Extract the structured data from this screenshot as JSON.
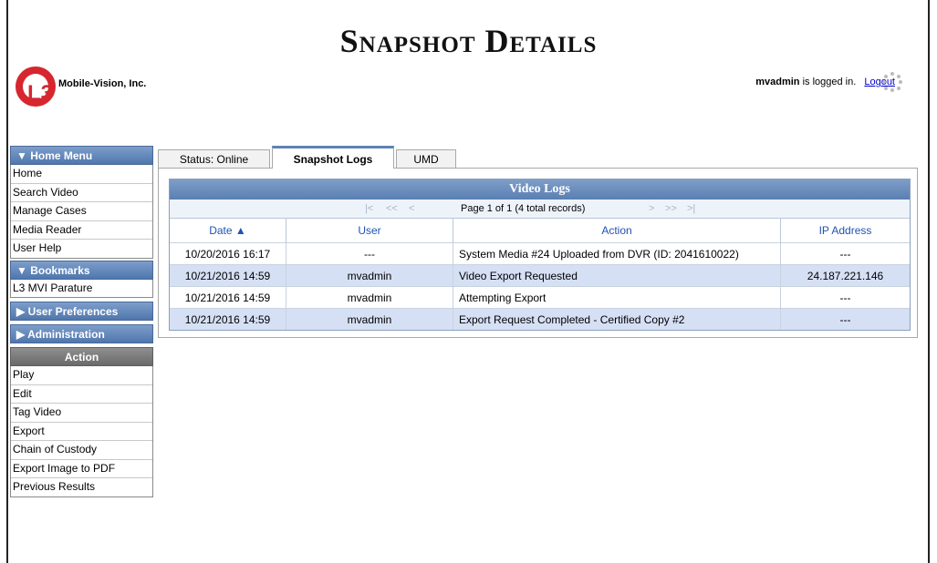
{
  "page": {
    "title": "Snapshot Details"
  },
  "brand": {
    "logo_text": "L3",
    "company": "Mobile-Vision, Inc."
  },
  "session": {
    "username": "mvadmin",
    "logged_in_suffix": " is logged in.",
    "logout_label": "Logout"
  },
  "sidebar": {
    "home_menu": {
      "header": "▼ Home Menu",
      "items": [
        "Home",
        "Search Video",
        "Manage Cases",
        "Media Reader",
        "User Help"
      ]
    },
    "bookmarks": {
      "header": "▼ Bookmarks",
      "items": [
        "L3 MVI Parature"
      ]
    },
    "user_preferences": {
      "header": "▶ User Preferences"
    },
    "administration": {
      "header": "▶ Administration"
    },
    "action": {
      "header": "Action",
      "items": [
        "Play",
        "Edit",
        "Tag Video",
        "Export",
        "Chain of Custody",
        "Export Image to PDF",
        "Previous Results"
      ]
    }
  },
  "tabs": [
    {
      "label": "Status: Online",
      "active": false
    },
    {
      "label": "Snapshot Logs",
      "active": true
    },
    {
      "label": "UMD",
      "active": false
    }
  ],
  "video_logs": {
    "title": "Video Logs",
    "pager_text": "Page 1 of 1 (4 total records)",
    "pager_icons": {
      "first": "|<",
      "prev_page": "<<",
      "prev": "<",
      "next": ">",
      "next_page": ">>",
      "last": ">|"
    },
    "columns": [
      "Date ▲",
      "User",
      "Action",
      "IP Address"
    ],
    "rows": [
      [
        "10/20/2016 16:17",
        "---",
        "System Media #24 Uploaded from DVR (ID: 2041610022)",
        "---"
      ],
      [
        "10/21/2016 14:59",
        "mvadmin",
        "Video Export Requested",
        "24.187.221.146"
      ],
      [
        "10/21/2016 14:59",
        "mvadmin",
        "Attempting Export",
        "---"
      ],
      [
        "10/21/2016 14:59",
        "mvadmin",
        "Export Request Completed - Certified Copy #2",
        "---"
      ]
    ]
  },
  "colors": {
    "header_blue": "#5a7fb2",
    "row_highlight": "#d6e0f5",
    "column_header_text": "#1f53b3",
    "logo_red": "#d6262f"
  }
}
